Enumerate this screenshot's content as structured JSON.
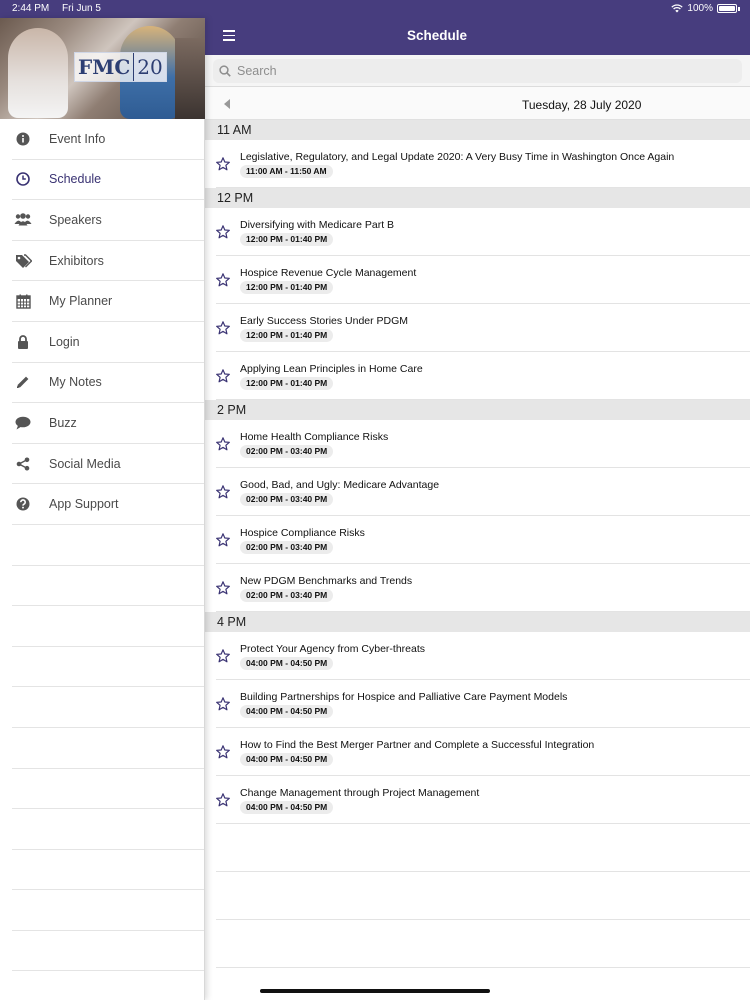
{
  "status_bar": {
    "time": "2:44 PM",
    "date": "Fri Jun 5",
    "battery": "100%"
  },
  "sidebar": {
    "logo_text": "FMC",
    "logo_year": "20",
    "items": [
      {
        "label": "Event Info",
        "icon": "info-icon",
        "active": false
      },
      {
        "label": "Schedule",
        "icon": "clock-icon",
        "active": true
      },
      {
        "label": "Speakers",
        "icon": "people-icon",
        "active": false
      },
      {
        "label": "Exhibitors",
        "icon": "tags-icon",
        "active": false
      },
      {
        "label": "My Planner",
        "icon": "calendar-icon",
        "active": false
      },
      {
        "label": "Login",
        "icon": "lock-icon",
        "active": false
      },
      {
        "label": "My Notes",
        "icon": "pencil-icon",
        "active": false
      },
      {
        "label": "Buzz",
        "icon": "chat-bubble-icon",
        "active": false
      },
      {
        "label": "Social Media",
        "icon": "share-icon",
        "active": false
      },
      {
        "label": "App Support",
        "icon": "question-icon",
        "active": false
      }
    ]
  },
  "header": {
    "title": "Schedule"
  },
  "search": {
    "placeholder": "Search"
  },
  "date_nav": {
    "date": "Tuesday, 28 July 2020"
  },
  "colors": {
    "brand": "#473d7e",
    "section_bg": "#e6e6e6",
    "active_text": "#3a3373"
  },
  "schedule": [
    {
      "time": "11 AM",
      "events": [
        {
          "title": "Legislative, Regulatory, and Legal Update 2020: A Very Busy Time in Washington Once Again",
          "time": "11:00 AM - 11:50 AM"
        }
      ]
    },
    {
      "time": "12 PM",
      "events": [
        {
          "title": "Diversifying with Medicare Part B",
          "time": "12:00 PM - 01:40 PM"
        },
        {
          "title": "Hospice Revenue Cycle Management",
          "time": "12:00 PM - 01:40 PM"
        },
        {
          "title": "Early Success Stories Under PDGM",
          "time": "12:00 PM - 01:40 PM"
        },
        {
          "title": "Applying Lean Principles in Home Care",
          "time": "12:00 PM - 01:40 PM"
        }
      ]
    },
    {
      "time": "2 PM",
      "events": [
        {
          "title": "Home Health Compliance Risks",
          "time": "02:00 PM - 03:40 PM"
        },
        {
          "title": "Good, Bad, and Ugly: Medicare Advantage",
          "time": "02:00 PM - 03:40 PM"
        },
        {
          "title": "Hospice Compliance Risks",
          "time": "02:00 PM - 03:40 PM"
        },
        {
          "title": "New PDGM Benchmarks and Trends",
          "time": "02:00 PM - 03:40 PM"
        }
      ]
    },
    {
      "time": "4 PM",
      "events": [
        {
          "title": "Protect Your Agency from Cyber-threats",
          "time": "04:00 PM - 04:50 PM"
        },
        {
          "title": "Building Partnerships for Hospice and Palliative Care Payment Models",
          "time": "04:00 PM - 04:50 PM"
        },
        {
          "title": "How to Find the Best Merger Partner and Complete a Successful Integration",
          "time": "04:00 PM - 04:50 PM"
        },
        {
          "title": "Change Management through Project Management",
          "time": "04:00 PM - 04:50 PM"
        }
      ]
    }
  ]
}
